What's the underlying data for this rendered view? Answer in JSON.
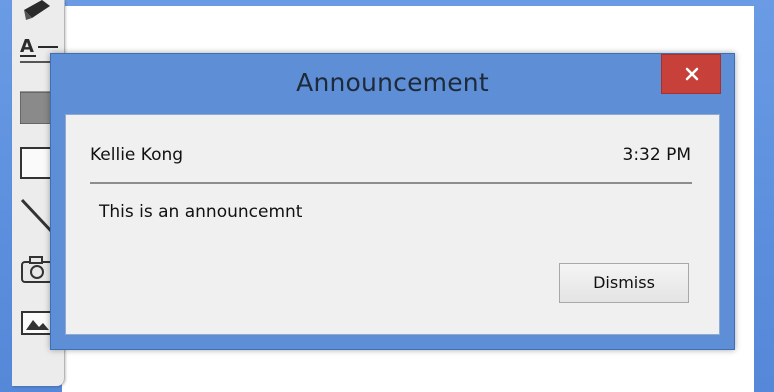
{
  "window": {
    "title": "Announcement",
    "close_icon": "close-icon"
  },
  "announcement": {
    "sender": "Kellie Kong",
    "time": "3:32 PM",
    "message": "This is an announcemnt"
  },
  "actions": {
    "dismiss_label": "Dismiss"
  },
  "toolbar": {
    "tools": [
      "pencil-icon",
      "text-format-icon",
      "fill-color-icon",
      "rectangle-icon",
      "line-icon",
      "camera-icon",
      "image-icon"
    ]
  },
  "colors": {
    "desktop": "#5f93e0",
    "dialog_frame": "#5d8ed6",
    "close_button": "#c7403a",
    "dialog_body": "#f0f0f0"
  }
}
